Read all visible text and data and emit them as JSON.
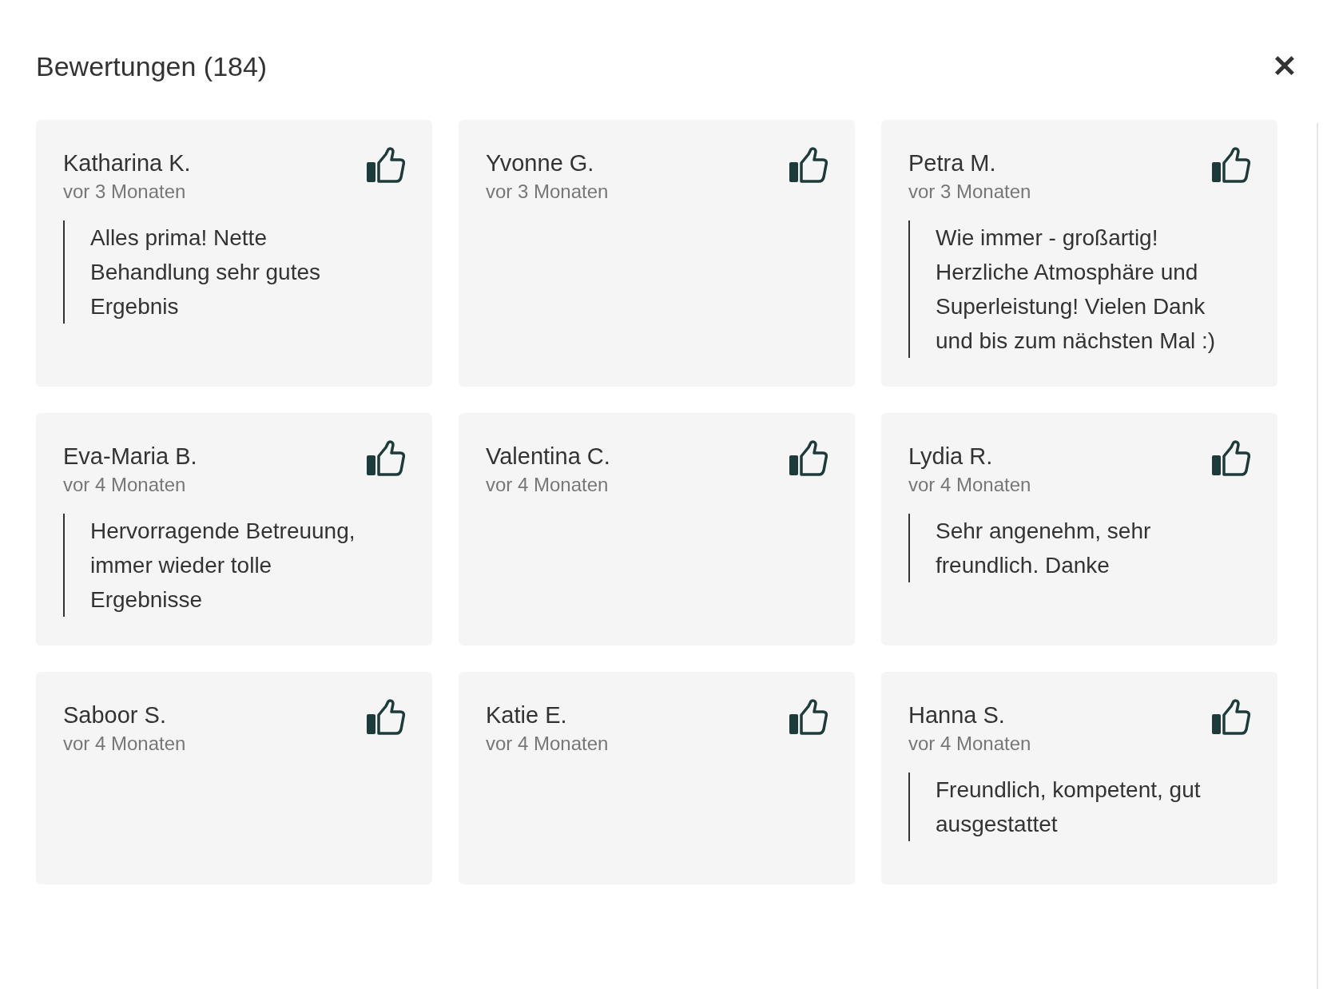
{
  "dialog": {
    "title": "Bewertungen (184)",
    "close_label": "✕"
  },
  "reviews": [
    {
      "name": "Katharina K.",
      "time": "vor 3 Monaten",
      "text": "Alles prima! Nette Behandlung sehr gutes Ergebnis"
    },
    {
      "name": "Yvonne G.",
      "time": "vor 3 Monaten"
    },
    {
      "name": "Petra M.",
      "time": "vor 3 Monaten",
      "text": "Wie immer - großartig! Herzliche Atmosphäre und Superleistung! Vielen Dank und bis zum nächsten Mal :)"
    },
    {
      "name": "Eva-Maria B.",
      "time": "vor 4 Monaten",
      "text": "Hervorragende Betreuung, immer wieder tolle Ergebnisse"
    },
    {
      "name": "Valentina C.",
      "time": "vor 4 Monaten"
    },
    {
      "name": "Lydia R.",
      "time": "vor 4 Monaten",
      "text": "Sehr angenehm, sehr freundlich. Danke"
    },
    {
      "name": "Saboor S.",
      "time": "vor 4 Monaten"
    },
    {
      "name": "Katie E.",
      "time": "vor 4 Monaten"
    },
    {
      "name": "Hanna S.",
      "time": "vor 4 Monaten",
      "text": "Freundlich, kompetent, gut ausgestattet"
    }
  ]
}
